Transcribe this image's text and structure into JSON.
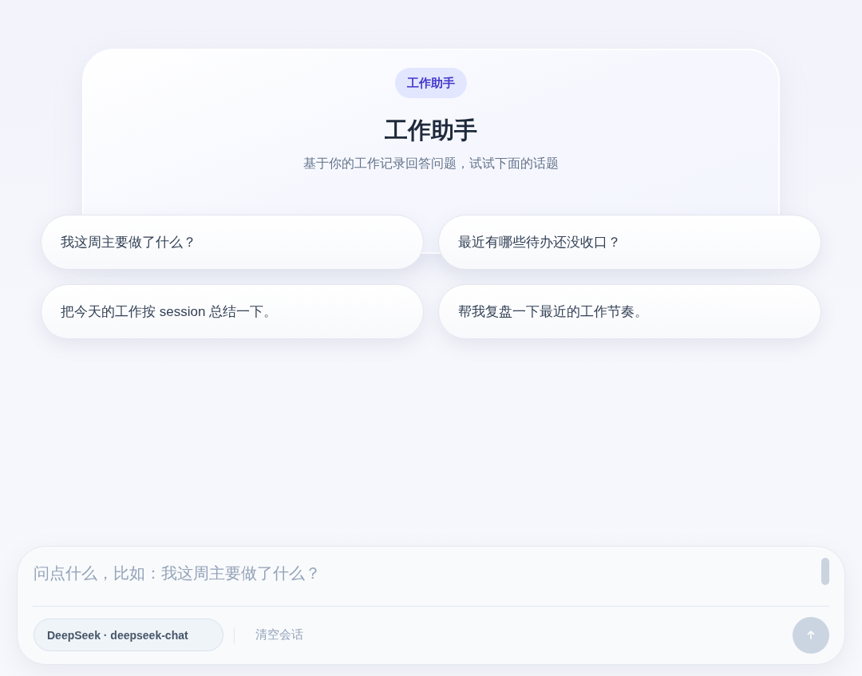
{
  "header": {
    "badge": "工作助手",
    "title": "工作助手",
    "subtitle": "基于你的工作记录回答问题，试试下面的话题"
  },
  "suggestions": [
    "我这周主要做了什么？",
    "最近有哪些待办还没收口？",
    "把今天的工作按 session 总结一下。",
    "帮我复盘一下最近的工作节奏。"
  ],
  "composer": {
    "placeholder": "问点什么，比如：我这周主要做了什么？",
    "model": "DeepSeek · deepseek-chat",
    "clear_button": "清空会话",
    "send_button": {
      "disabled": true
    }
  }
}
